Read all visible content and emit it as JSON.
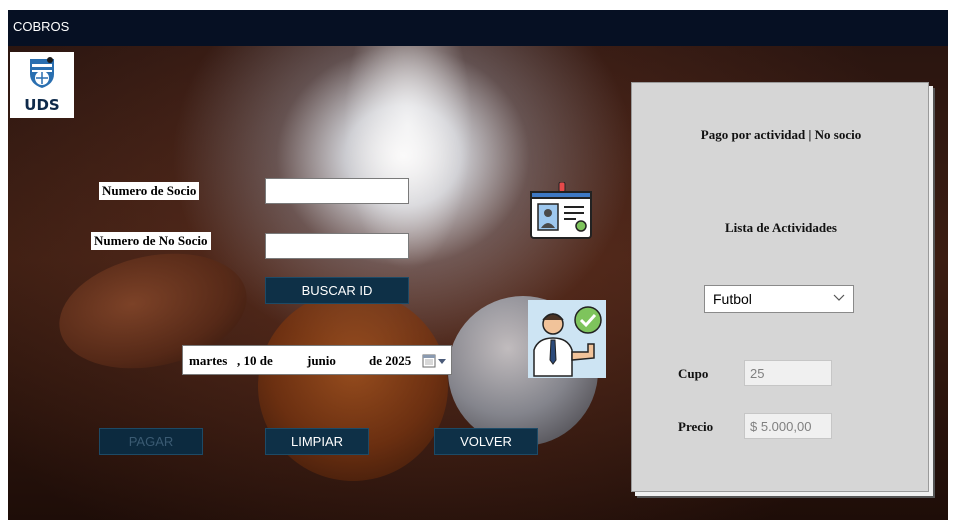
{
  "window": {
    "title": "COBROS"
  },
  "logo": {
    "text": "UDS",
    "icon": "soccer-shield-logo"
  },
  "form": {
    "socio_label": "Numero de Socio",
    "socio_value": "",
    "no_socio_label": "Numero de No Socio",
    "no_socio_value": "",
    "buscar_button": "BUSCAR ID",
    "date": {
      "weekday": "martes",
      "day": ", 10 de",
      "month": "junio",
      "year": "de 2025"
    },
    "pagar_button": "PAGAR",
    "limpiar_button": "LIMPIAR",
    "volver_button": "VOLVER"
  },
  "icons": {
    "id_card": "id-card-icon",
    "approved_person": "approved-person-icon",
    "calendar": "calendar-icon"
  },
  "panel": {
    "title": "Pago por actividad | No socio",
    "list_title": "Lista de Actividades",
    "activity_selected": "Futbol",
    "cupo_label": "Cupo",
    "cupo_value": "25",
    "precio_label": "Precio",
    "precio_value": "$ 5.000,00"
  },
  "colors": {
    "titlebar": "#061023",
    "button": "#0e3047",
    "panel": "#d6d6d6"
  }
}
